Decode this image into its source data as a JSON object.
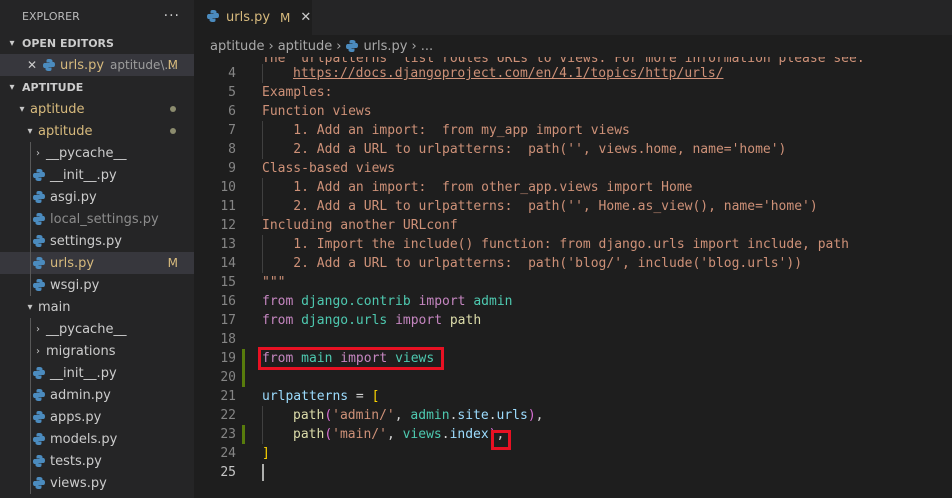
{
  "explorer": {
    "title": "EXPLORER",
    "more": "···",
    "open_editors": {
      "label": "OPEN EDITORS",
      "items": [
        {
          "name": "urls.py",
          "desc": "aptitude\\...",
          "badge": "M"
        }
      ]
    },
    "workspace": {
      "label": "APTITUDE",
      "tree": [
        {
          "label": "aptitude"
        },
        {
          "label": "aptitude"
        },
        {
          "label": "__pycache__"
        },
        {
          "label": "__init__.py"
        },
        {
          "label": "asgi.py"
        },
        {
          "label": "local_settings.py"
        },
        {
          "label": "settings.py"
        },
        {
          "label": "urls.py",
          "badge": "M"
        },
        {
          "label": "wsgi.py"
        },
        {
          "label": "main"
        },
        {
          "label": "__pycache__"
        },
        {
          "label": "migrations"
        },
        {
          "label": "__init__.py"
        },
        {
          "label": "admin.py"
        },
        {
          "label": "apps.py"
        },
        {
          "label": "models.py"
        },
        {
          "label": "tests.py"
        },
        {
          "label": "views.py"
        }
      ]
    }
  },
  "tab": {
    "title": "urls.py",
    "badge": "M",
    "close": "✕"
  },
  "breadcrumb": {
    "c1": "aptitude",
    "c2": "aptitude",
    "c3": "urls.py",
    "c4": "..."
  },
  "editor": {
    "line_numbers": [
      "4",
      "5",
      "6",
      "7",
      "8",
      "9",
      "10",
      "11",
      "12",
      "13",
      "14",
      "15",
      "16",
      "17",
      "18",
      "19",
      "20",
      "21",
      "22",
      "23",
      "24",
      "25"
    ],
    "line3_partial": "The `urlpatterns` list routes URLs to views. For more information please see:",
    "lines": {
      "l4": "https://docs.djangoproject.com/en/4.1/topics/http/urls/",
      "l5": "Examples:",
      "l6": "Function views",
      "l7": "    1. Add an import:  from my_app import views",
      "l8": "    2. Add a URL to urlpatterns:  path('', views.home, name='home')",
      "l9": "Class-based views",
      "l10": "    1. Add an import:  from other_app.views import Home",
      "l11": "    2. Add a URL to urlpatterns:  path('', Home.as_view(), name='home')",
      "l12": "Including another URLconf",
      "l13": "    1. Import the include() function: from django.urls import include, path",
      "l14": "    2. Add a URL to urlpatterns:  path('blog/', include('blog.urls'))",
      "l15": "\"\"\""
    },
    "tokens": {
      "from": "from",
      "import": "import",
      "django_contrib": "django.contrib",
      "admin": "admin",
      "django_urls": "django.urls",
      "path": "path",
      "main": "main",
      "views": "views",
      "urlpatterns": "urlpatterns",
      "eq": " = ",
      "lbr": "[",
      "rbr": "]",
      "path_fn": "path",
      "lp": "(",
      "rp": ")",
      "comma": ",",
      "comma_sp": ", ",
      "str_admin": "'admin/'",
      "admin_site": "admin",
      "dot": ".",
      "site": "site",
      "urls": "urls",
      "str_main": "'main/'",
      "views2": "views",
      "index": "index"
    }
  },
  "colors": {
    "highlight": "#e81123",
    "modified": "#d7ba7d",
    "python_icon": "#4b8bbe"
  }
}
